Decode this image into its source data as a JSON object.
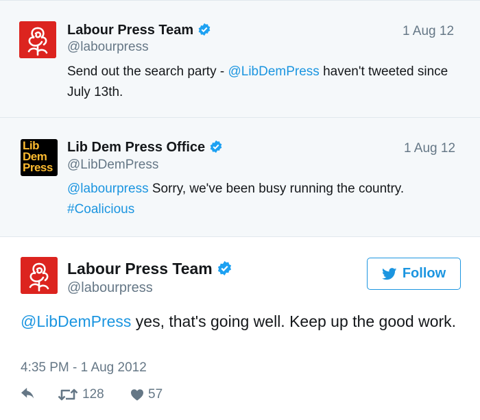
{
  "quoted_tweets": [
    {
      "name": "Labour Press Team",
      "handle": "@labourpress",
      "date": "1 Aug 12",
      "text_parts": [
        "Send out the search party - ",
        "@LibDemPress",
        " haven't tweeted since July 13th."
      ]
    },
    {
      "name": "Lib Dem Press Office",
      "handle": "@LibDemPress",
      "date": "1 Aug 12",
      "avatar_text": [
        "Lib",
        "Dem",
        "Press"
      ],
      "text_parts": [
        "@labourpress",
        " Sorry, we've been busy running the country. ",
        "#Coalicious"
      ]
    }
  ],
  "main_tweet": {
    "name": "Labour Press Team",
    "handle": "@labourpress",
    "follow_label": "Follow",
    "text_parts": [
      "@LibDemPress",
      " yes, that's going well. Keep up the good work."
    ],
    "timestamp": "4:35 PM - 1 Aug 2012",
    "retweets": "128",
    "likes": "57"
  },
  "colors": {
    "link": "#1b95e0",
    "labour_red": "#dc241f",
    "libdem_gold": "#fdbb30",
    "muted": "#657786"
  },
  "icons": [
    "labour-rose-icon",
    "verified-badge-icon",
    "twitter-bird-icon",
    "reply-icon",
    "retweet-icon",
    "heart-icon"
  ]
}
